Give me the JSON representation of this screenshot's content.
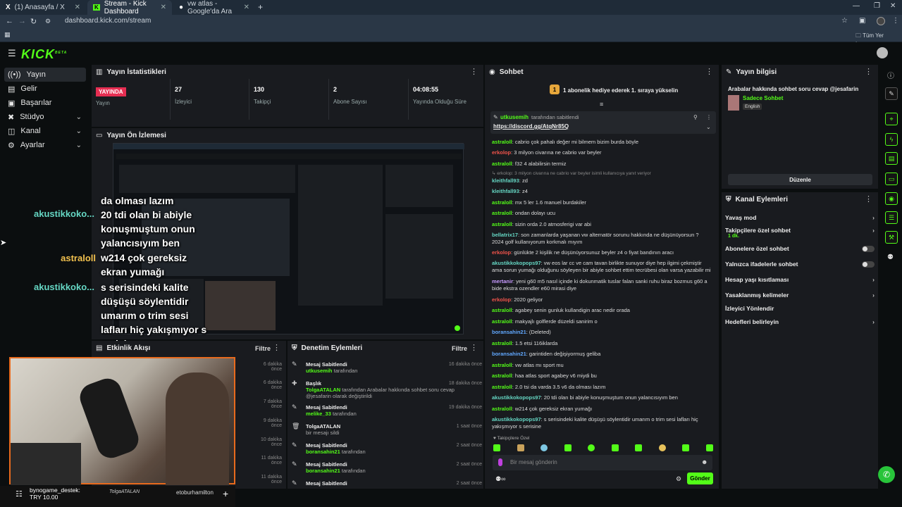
{
  "browser": {
    "tabs": [
      {
        "label": "(1) Anasayfa / X",
        "icon": "x-icon"
      },
      {
        "label": "Stream - Kick Dashboard",
        "icon": "kick-icon"
      },
      {
        "label": "vw atlas - Google'da Ara",
        "icon": "google-icon"
      }
    ],
    "url": "dashboard.kick.com/stream",
    "bookmarks_label": "Tüm Yer İşaretleri"
  },
  "app": {
    "logo": "KICK",
    "logo_beta": "BETA"
  },
  "sidebar": {
    "items": [
      {
        "label": "Yayın",
        "icon": "broadcast-icon"
      },
      {
        "label": "Gelir",
        "icon": "wallet-icon"
      },
      {
        "label": "Başarılar",
        "icon": "trophy-icon"
      },
      {
        "label": "Stüdyo",
        "icon": "studio-icon"
      },
      {
        "label": "Kanal",
        "icon": "channel-icon"
      },
      {
        "label": "Ayarlar",
        "icon": "gear-icon"
      }
    ]
  },
  "stats": {
    "title": "Yayın İstatistikleri",
    "live_badge": "YAYINDA",
    "live_label": "Yayın",
    "items": [
      {
        "value": "27",
        "label": "İzleyici"
      },
      {
        "value": "130",
        "label": "Takipçi"
      },
      {
        "value": "2",
        "label": "Abone Sayısı"
      },
      {
        "value": "04:08:55",
        "label": "Yayında Olduğu Süre"
      }
    ]
  },
  "preview": {
    "title": "Yayın Ön İzlemesi"
  },
  "overlay": {
    "lines": [
      {
        "name": "akustikkoko...",
        "text": "da olması lazım\n20 tdi olan bi abiyle\nkonuşmuştum onun\nyalancısıyım ben"
      },
      {
        "name": "astraloll",
        "text": "w214 çok gereksiz\nekran yumağı"
      },
      {
        "name": "akustikkoko...",
        "text": "s serisindeki kalite\ndüşüşü söylentidir\numarım o trim sesi\nlafları hiç yakışmıyor s\nserisine"
      }
    ]
  },
  "activity": {
    "title": "Etkinlik Akışı",
    "filter": "Filtre",
    "times": [
      "6 dakika önce",
      "6 dakika önce",
      "7 dakika önce",
      "9 dakika önce",
      "10 dakika önce",
      "11 dakika önce",
      "11 dakika önce",
      "12 dakika önce",
      "14 dakika önce"
    ],
    "donation_user": "bynogame_destek:",
    "donation_amount": "TRY 10.00",
    "bottom_names": [
      "TolgaATALAN",
      "etoburhamilton"
    ]
  },
  "moderation": {
    "title": "Denetim Eylemleri",
    "filter": "Filtre",
    "rows": [
      {
        "icon": "pin-icon",
        "title": "Mesaj Sabitlendi",
        "user": "utkusemih",
        "suffix": "tarafından",
        "time": "16 dakika önce"
      },
      {
        "icon": "title-icon",
        "title": "Başlık",
        "user": "TolgaATALAN",
        "suffix": "tarafından Arabalar hakkında sohbet soru cevap @jesafarin olarak değiştirildi",
        "time": "18 dakika önce"
      },
      {
        "icon": "pin-icon",
        "title": "Mesaj Sabitlendi",
        "user": "melike_33",
        "suffix": "tarafından",
        "time": "19 dakika önce"
      },
      {
        "icon": "trash-icon",
        "title": "TolgaATALAN",
        "user": "",
        "suffix": "bir mesajı sildi",
        "time": "1 saat önce"
      },
      {
        "icon": "pin-icon",
        "title": "Mesaj Sabitlendi",
        "user": "boransahin21",
        "suffix": "tarafından",
        "time": "2 saat önce"
      },
      {
        "icon": "pin-icon",
        "title": "Mesaj Sabitlendi",
        "user": "boransahin21",
        "suffix": "tarafından",
        "time": "2 saat önce"
      },
      {
        "icon": "pin-icon",
        "title": "Mesaj Sabitlendi",
        "user": "",
        "suffix": "",
        "time": "2 saat önce"
      }
    ]
  },
  "chat": {
    "title": "Sohbet",
    "gift_banner": "1 abonelik hediye ederek 1. sıraya yükselin",
    "pinned_user": "utkusemih",
    "pinned_suffix": "tarafından sabitlendi",
    "pinned_link": "https://discord.gg/AtqNr85Q",
    "messages": [
      {
        "user": "astraloll",
        "color": "g",
        "text": ": cabrio çok pahalı değer mi bilmem bizim burda böyle"
      },
      {
        "user": "erkolop",
        "color": "r",
        "text": ": 3 milyon civarına ne cabrio var beyler"
      },
      {
        "user": "astraloll",
        "color": "g",
        "text": ": f32 4 alabilirsin termiz"
      },
      {
        "user": "",
        "color": "g",
        "text": "↳ erkolop: 3 milyon civarına ne cabrio var beyler isimli kullanıcıya yanıt veriyor"
      },
      {
        "user": "kleithfall93",
        "color": "c",
        "text": ": zd"
      },
      {
        "user": "kleithfall93",
        "color": "c",
        "text": ": z4"
      },
      {
        "user": "astraloll",
        "color": "g",
        "text": ": mx 5 ler 1.6 manuel burdakiler"
      },
      {
        "user": "astraloll",
        "color": "g",
        "text": ": ondan dolayı ucu"
      },
      {
        "user": "astraloll",
        "color": "g",
        "text": ": sizin orda 2.0 atmosferigi var abi"
      },
      {
        "user": "bellatrix17",
        "color": "c",
        "text": ": son zamanlarda yaşanan vw alternatör sorunu hakkında ne düşünüyorsun ? 2024 golf kullanıyorum korkmalı mıyım"
      },
      {
        "user": "erkolop",
        "color": "r",
        "text": ": günlükte 2 kişilik ne düşünüyorsunuz beyler z4 o fiyat bandının aracı"
      },
      {
        "user": "akustikkokopops97",
        "color": "c",
        "text": ": vw eos lar cc ve cam tavan birlikte sunuyor diye hep ilgimi çekmiştir ama sorun yumağı olduğunu söyleyen bir abiyle sohbet ettim tecrübesi olan varsa yazabilir mi"
      },
      {
        "user": "mertanir",
        "color": "p",
        "text": ": yeni g60 m5 nasıl içinde ki dokunmatik tuslar falan sanki ruhu biraz bozmus g60 a bide ekstra ozendler e60 mirasi diye"
      },
      {
        "user": "erkolop",
        "color": "r",
        "text": ": 2020 geliyor"
      },
      {
        "user": "astraloll",
        "color": "g",
        "text": ": agabey senin gunluk kullandigin arac nedir orada"
      },
      {
        "user": "astraloll",
        "color": "g",
        "text": ": makyajlı golflerde düzeldi sanirim o"
      },
      {
        "user": "boransahin21",
        "color": "b",
        "text": ": (Deleted)"
      },
      {
        "user": "astraloll",
        "color": "g",
        "text": ": 1.5 etsi 116iklarda"
      },
      {
        "user": "boransahin21",
        "color": "b",
        "text": ": garintiden değişiyormuş geliba"
      },
      {
        "user": "astraloll",
        "color": "g",
        "text": ": vw atlas mı sport mu"
      },
      {
        "user": "astraloll",
        "color": "g",
        "text": ": haa atlas sport agabey v6 miydi bu"
      },
      {
        "user": "astraloll",
        "color": "g",
        "text": ": 2.0 tsi da varda 3.5 v6 da olması lazım"
      },
      {
        "user": "akustikkokopops97",
        "color": "c",
        "text": ": 20 tdi olan bi abiyle konuşmuştum onun yalancısıyım ben"
      },
      {
        "user": "astraloll",
        "color": "g",
        "text": ": w214 çok gereksiz ekran yumağı"
      },
      {
        "user": "akustikkokopops97",
        "color": "c",
        "text": ": s serisindeki kalite düşüşü söylentidir umarım o trim sesi lafları hiç yakışmıyor s serisine"
      }
    ],
    "followers_only": "Takipçilere Özel",
    "input_placeholder": "Bir mesaj gönderin",
    "send_label": "Gönder"
  },
  "stream_info": {
    "title": "Yayın bilgisi",
    "stream_title": "Arabalar hakkında sohbet soru cevap @jesafarin",
    "category": "Sadece Sohbet",
    "language": "English",
    "edit_label": "Düzenle"
  },
  "channel_actions": {
    "title": "Kanal Eylemleri",
    "items": [
      {
        "label": "Yavaş mod",
        "type": "arrow"
      },
      {
        "label": "Takipçilere özel sohbet",
        "sub": "1 dk.",
        "type": "arrow"
      },
      {
        "label": "Abonelere özel sohbet",
        "type": "toggle"
      },
      {
        "label": "Yalnızca ifadelerle sohbet",
        "type": "toggle"
      },
      {
        "label": "Hesap yaşı kısıtlaması",
        "type": "arrow"
      },
      {
        "label": "Yasaklanmış kelimeler",
        "type": "arrow"
      },
      {
        "label": "İzleyici Yönlendir",
        "type": "none"
      },
      {
        "label": "Hedefleri belirleyin",
        "type": "arrow"
      }
    ]
  },
  "colors": {
    "accent": "#53fc18",
    "live": "#e62e52",
    "panel": "#191b1f",
    "bg": "#0b0e0f"
  }
}
